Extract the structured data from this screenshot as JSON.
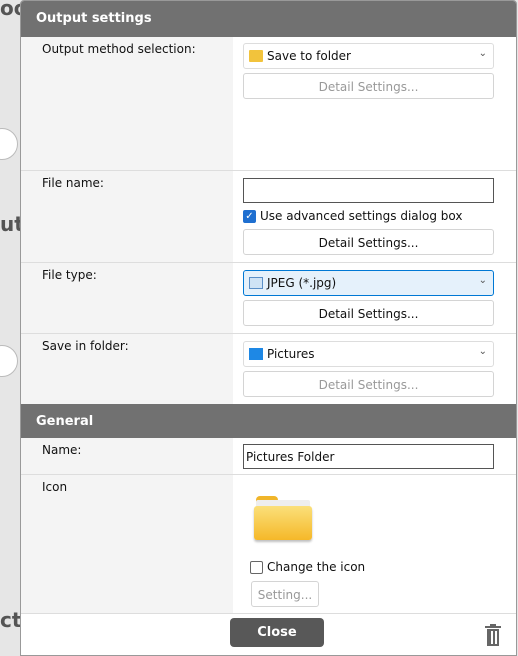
{
  "background": {
    "frag1": "oo",
    "frag2": "ut",
    "frag3": "ct"
  },
  "output_settings": {
    "title": "Output settings",
    "output_method": {
      "label": "Output method selection:",
      "value": "Save to folder",
      "detail": "Detail Settings..."
    },
    "file_name": {
      "label": "File name:",
      "value": "",
      "advanced_label": "Use advanced settings dialog box",
      "advanced_checked": true,
      "detail": "Detail Settings..."
    },
    "file_type": {
      "label": "File type:",
      "value": "JPEG (*.jpg)",
      "detail": "Detail Settings..."
    },
    "save_in_folder": {
      "label": "Save in folder:",
      "value": "Pictures",
      "detail": "Detail Settings..."
    }
  },
  "general": {
    "title": "General",
    "name": {
      "label": "Name:",
      "value": "Pictures Folder"
    },
    "icon": {
      "label": "Icon",
      "change_label": "Change the icon",
      "change_checked": false,
      "setting": "Setting..."
    }
  },
  "footer": {
    "close": "Close"
  }
}
